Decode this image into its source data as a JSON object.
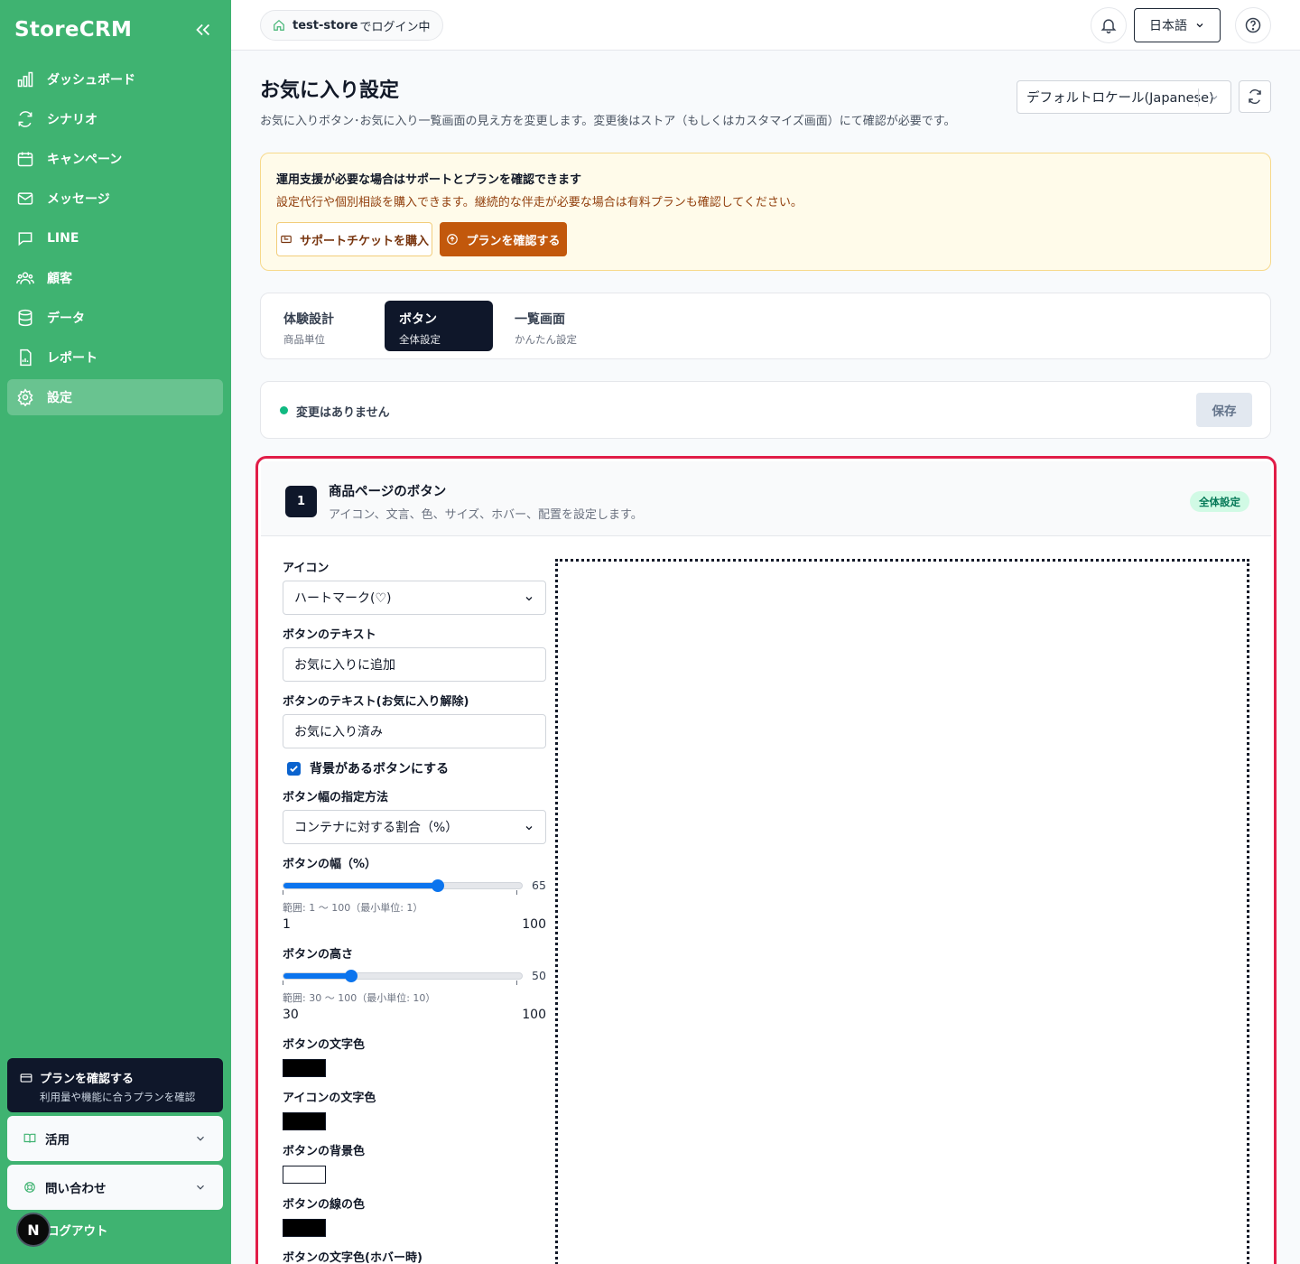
{
  "sidebar": {
    "brand": "StoreCRM",
    "items": [
      {
        "label": "ダッシュボード",
        "icon": "bar-chart-icon"
      },
      {
        "label": "シナリオ",
        "icon": "cycle-icon"
      },
      {
        "label": "キャンペーン",
        "icon": "calendar-icon"
      },
      {
        "label": "メッセージ",
        "icon": "mail-icon"
      },
      {
        "label": "LINE",
        "icon": "chat-icon"
      },
      {
        "label": "顧客",
        "icon": "users-icon"
      },
      {
        "label": "データ",
        "icon": "database-icon"
      },
      {
        "label": "レポート",
        "icon": "report-icon"
      },
      {
        "label": "設定",
        "icon": "gear-icon"
      }
    ],
    "plan_card": {
      "title": "プランを確認する",
      "subtitle": "利用量や機能に合うプランを確認"
    },
    "usage_label": "活用",
    "contact_label": "問い合わせ",
    "avatar_initial": "N",
    "logout_label": "ログアウト"
  },
  "header": {
    "store_name": "test-store",
    "login_suffix": "でログイン中",
    "language": "日本語"
  },
  "page": {
    "title": "お気に入り設定",
    "description": "お気に入りボタン･お気に入り一覧画面の見え方を変更します。変更後はストア（もしくはカスタマイズ画面）にて確認が必要です。",
    "locale": "デフォルトロケール(Japanese)"
  },
  "notice": {
    "title": "運用支援が必要な場合はサポートとプランを確認できます",
    "description": "設定代行や個別相談を購入できます。継続的な伴走が必要な場合は有料プランも確認してください。",
    "ticket_button": "サポートチケットを購入",
    "plan_button": "プランを確認する"
  },
  "tabs": [
    {
      "label": "体験設計",
      "sub": "商品単位"
    },
    {
      "label": "ボタン",
      "sub": "全体設定"
    },
    {
      "label": "一覧画面",
      "sub": "かんたん設定"
    }
  ],
  "status": {
    "text": "変更はありません",
    "save_label": "保存"
  },
  "section": {
    "number": "1",
    "title": "商品ページのボタン",
    "description": "アイコン、文言、色、サイズ、ホバー、配置を設定します。",
    "badge": "全体設定",
    "icon_label": "アイコン",
    "icon_value": "ハートマーク(♡)",
    "text_label": "ボタンのテキスト",
    "text_value": "お気に入りに追加",
    "text_remove_label": "ボタンのテキスト(お気に入り解除)",
    "text_remove_value": "お気に入り済み",
    "bg_checkbox_label": "背景があるボタンにする",
    "bg_checkbox_checked": true,
    "width_mode_label": "ボタン幅の指定方法",
    "width_mode_value": "コンテナに対する割合（%）",
    "width": {
      "label": "ボタンの幅（%）",
      "value": 65,
      "value_text": "65",
      "min": 1,
      "max": 100,
      "min_text": "1",
      "max_text": "100",
      "range_text": "範囲: 1 〜 100（最小単位: 1）"
    },
    "height": {
      "label": "ボタンの高さ",
      "value": 50,
      "value_text": "50",
      "min": 30,
      "max": 100,
      "min_text": "30",
      "max_text": "100",
      "range_text": "範囲: 30 〜 100（最小単位: 10）"
    },
    "colors": [
      {
        "label": "ボタンの文字色",
        "color": "#000000"
      },
      {
        "label": "アイコンの文字色",
        "color": "#000000"
      },
      {
        "label": "ボタンの背景色",
        "color": "#ffffff"
      },
      {
        "label": "ボタンの線の色",
        "color": "#000000"
      },
      {
        "label": "ボタンの文字色(ホバー時)",
        "color": "#000000"
      }
    ]
  }
}
